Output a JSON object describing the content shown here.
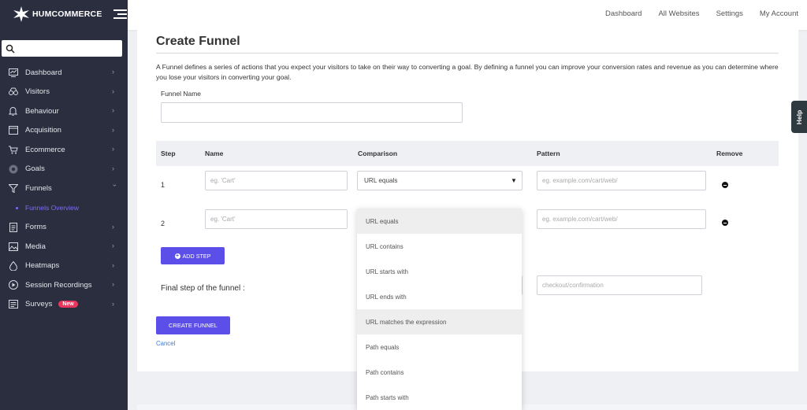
{
  "brand": {
    "name": "HUMCOMMERCE"
  },
  "sidebar": {
    "search_placeholder": "",
    "items": [
      {
        "label": "Dashboard",
        "icon": "dashboard-icon"
      },
      {
        "label": "Visitors",
        "icon": "visitors-icon"
      },
      {
        "label": "Behaviour",
        "icon": "bell-icon"
      },
      {
        "label": "Acquisition",
        "icon": "acquisition-icon"
      },
      {
        "label": "Ecommerce",
        "icon": "cart-icon"
      },
      {
        "label": "Goals",
        "icon": "target-icon"
      },
      {
        "label": "Funnels",
        "icon": "funnel-icon"
      },
      {
        "label": "Forms",
        "icon": "form-icon"
      },
      {
        "label": "Media",
        "icon": "media-icon"
      },
      {
        "label": "Heatmaps",
        "icon": "heatmap-icon"
      },
      {
        "label": "Session Recordings",
        "icon": "play-icon"
      },
      {
        "label": "Surveys",
        "icon": "survey-icon"
      }
    ],
    "sub_item": "Funnels Overview",
    "surveys_badge": "New"
  },
  "topnav": {
    "dashboard": "Dashboard",
    "all_websites": "All Websites",
    "settings": "Settings",
    "my_account": "My Account"
  },
  "form": {
    "title": "Create Funnel",
    "description": "A Funnel defines a series of actions that you expect your visitors to take on their way to converting a goal. By defining a funnel you can improve your conversion rates and revenue as you can determine where you lose your visitors in converting your goal.",
    "funnel_name_label": "Funnel Name",
    "funnel_name_value": "",
    "headers": {
      "step": "Step",
      "name": "Name",
      "comparison": "Comparison",
      "pattern": "Pattern",
      "remove": "Remove"
    },
    "rows": [
      {
        "step": "1",
        "name_placeholder": "eg. 'Cart'",
        "comparison": "URL equals",
        "pattern_placeholder": "eg. example.com/cart/web/"
      },
      {
        "step": "2",
        "name_placeholder": "eg. 'Cart'",
        "comparison": "",
        "pattern_placeholder": "eg. example.com/cart/web/"
      }
    ],
    "add_step_label": "ADD STEP",
    "final_step_label": "Final step of the funnel :",
    "final_pattern_placeholder": "checkout/confirmation",
    "create_label": "CREATE FUNNEL",
    "cancel_label": "Cancel"
  },
  "dropdown": {
    "options": [
      "URL equals",
      "URL contains",
      "URL starts with",
      "URL ends with",
      "URL matches the expression",
      "Path equals",
      "Path contains",
      "Path starts with"
    ]
  },
  "help": {
    "label": "Help"
  },
  "colors": {
    "sidebar": "#2b2e3f",
    "accent": "#5c4ee8",
    "active_sub": "#7b6cf6",
    "badge": "#e8365d"
  }
}
